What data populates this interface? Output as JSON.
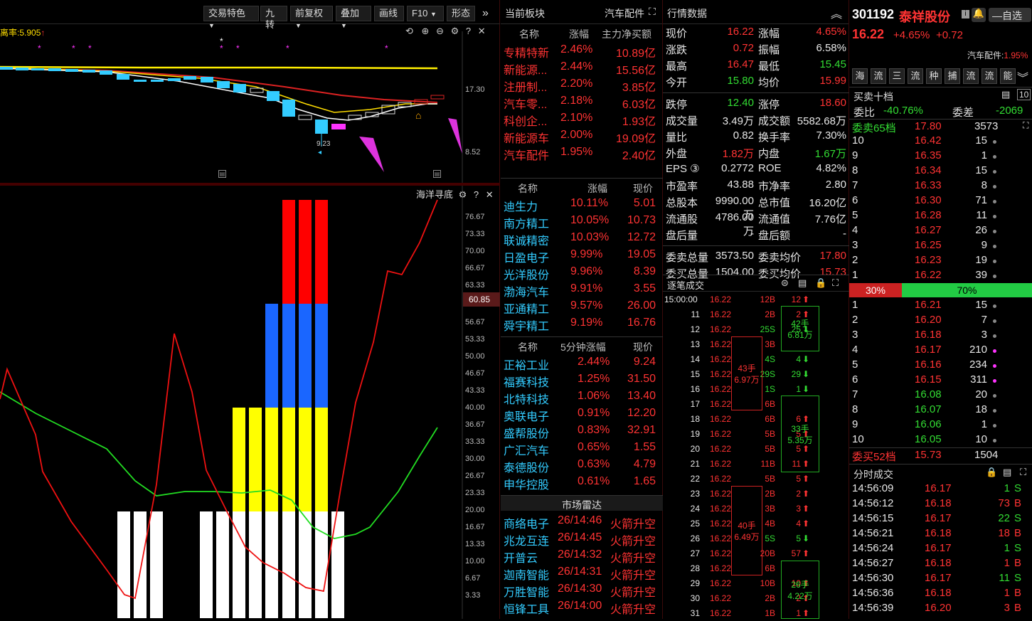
{
  "toolbar": {
    "items": [
      "交易特色",
      "九转",
      "前复权",
      "叠加",
      "画线",
      "F10",
      "形态"
    ],
    "ratio_label": "离率:5.905"
  },
  "kchart": {
    "axis": [
      "17.30",
      "8.52"
    ],
    "low_label": "9.23"
  },
  "indicator": {
    "name": "海洋寻底",
    "axis": [
      "76.67",
      "73.33",
      "70.00",
      "66.67",
      "63.33",
      "60.85",
      "56.67",
      "53.33",
      "50.00",
      "46.67",
      "43.33",
      "40.00",
      "36.67",
      "33.33",
      "30.00",
      "26.67",
      "23.33",
      "20.00",
      "16.67",
      "13.33",
      "10.00",
      "6.67",
      "3.33"
    ],
    "current_value": "60.85"
  },
  "sector": {
    "header": "当前板块",
    "current": "汽车配件",
    "cols": [
      "名称",
      "涨幅",
      "主力净买额"
    ],
    "rows": [
      {
        "name": "专精特新",
        "chg": "2.46%",
        "amt": "10.89亿"
      },
      {
        "name": "新能源...",
        "chg": "2.44%",
        "amt": "15.56亿"
      },
      {
        "name": "注册制...",
        "chg": "2.20%",
        "amt": "3.85亿"
      },
      {
        "name": "汽车零...",
        "chg": "2.18%",
        "amt": "6.03亿"
      },
      {
        "name": "科创企...",
        "chg": "2.10%",
        "amt": "1.93亿"
      },
      {
        "name": "新能源车",
        "chg": "2.00%",
        "amt": "19.09亿"
      },
      {
        "name": "汽车配件",
        "chg": "1.95%",
        "amt": "2.40亿"
      }
    ]
  },
  "leaders": {
    "cols": [
      "名称",
      "涨幅",
      "现价"
    ],
    "rows": [
      {
        "name": "迪生力",
        "chg": "10.11%",
        "price": "5.01"
      },
      {
        "name": "南方精工",
        "chg": "10.05%",
        "price": "10.73"
      },
      {
        "name": "联诚精密",
        "chg": "10.03%",
        "price": "12.72"
      },
      {
        "name": "日盈电子",
        "chg": "9.99%",
        "price": "19.05"
      },
      {
        "name": "光洋股份",
        "chg": "9.96%",
        "price": "8.39"
      },
      {
        "name": "渤海汽车",
        "chg": "9.91%",
        "price": "3.55"
      },
      {
        "name": "亚通精工",
        "chg": "9.57%",
        "price": "26.00"
      },
      {
        "name": "舜宇精工",
        "chg": "9.19%",
        "price": "16.76"
      }
    ]
  },
  "five_min": {
    "cols": [
      "名称",
      "5分钟涨幅",
      "现价"
    ],
    "rows": [
      {
        "name": "正裕工业",
        "chg": "2.44%",
        "price": "9.24"
      },
      {
        "name": "福赛科技",
        "chg": "1.25%",
        "price": "31.50"
      },
      {
        "name": "北特科技",
        "chg": "1.06%",
        "price": "13.40"
      },
      {
        "name": "奥联电子",
        "chg": "0.91%",
        "price": "12.20"
      },
      {
        "name": "盛帮股份",
        "chg": "0.83%",
        "price": "32.91"
      },
      {
        "name": "广汇汽车",
        "chg": "0.65%",
        "price": "1.55"
      },
      {
        "name": "泰德股份",
        "chg": "0.63%",
        "price": "4.79"
      },
      {
        "name": "申华控股",
        "chg": "0.61%",
        "price": "1.65"
      }
    ]
  },
  "radar": {
    "title": "市场雷达",
    "rows": [
      {
        "name": "商络电子",
        "time": "26/14:46",
        "event": "火箭升空"
      },
      {
        "name": "兆龙互连",
        "time": "26/14:45",
        "event": "火箭升空"
      },
      {
        "name": "开普云",
        "time": "26/14:32",
        "event": "火箭升空"
      },
      {
        "name": "迦南智能",
        "time": "26/14:31",
        "event": "火箭升空"
      },
      {
        "name": "万胜智能",
        "time": "26/14:30",
        "event": "火箭升空"
      },
      {
        "name": "恒锋工具",
        "time": "26/14:00",
        "event": "火箭升空"
      }
    ]
  },
  "quote": {
    "title": "行情数据",
    "rows": [
      [
        "现价",
        "16.22",
        "涨幅",
        "4.65%"
      ],
      [
        "涨跌",
        "0.72",
        "振幅",
        "6.58%"
      ],
      [
        "最高",
        "16.47",
        "最低",
        "15.45"
      ],
      [
        "今开",
        "15.80",
        "均价",
        "15.99"
      ],
      [
        "跌停",
        "12.40",
        "涨停",
        "18.60"
      ],
      [
        "成交量",
        "3.49万",
        "成交额",
        "5582.68万"
      ],
      [
        "量比",
        "0.82",
        "换手率",
        "7.30%"
      ],
      [
        "外盘",
        "1.82万",
        "内盘",
        "1.67万"
      ],
      [
        "EPS ③",
        "0.2772",
        "ROE",
        "4.82%"
      ],
      [
        "市盈率",
        "43.88",
        "市净率",
        "2.80"
      ],
      [
        "总股本",
        "9990.00万",
        "总市值",
        "16.20亿"
      ],
      [
        "流通股",
        "4786.00万",
        "流通值",
        "7.76亿"
      ],
      [
        "盘后量",
        "-",
        "盘后额",
        "-"
      ],
      [
        "委卖总量",
        "3573.50",
        "委卖均价",
        "17.80"
      ],
      [
        "委买总量",
        "1504.00",
        "委买均价",
        "15.73"
      ]
    ]
  },
  "ticks": {
    "title": "逐笔成交",
    "rows": [
      [
        "15:00:00",
        "16.22",
        "12B",
        "12"
      ],
      [
        "11",
        "16.22",
        "2B",
        "2"
      ],
      [
        "12",
        "16.22",
        "25S",
        "25"
      ],
      [
        "13",
        "16.22",
        "3B",
        ""
      ],
      [
        "14",
        "16.22",
        "4S",
        "4"
      ],
      [
        "15",
        "16.22",
        "29S",
        "29"
      ],
      [
        "16",
        "16.22",
        "1S",
        "1"
      ],
      [
        "17",
        "16.22",
        "6B",
        ""
      ],
      [
        "18",
        "16.22",
        "6B",
        "6"
      ],
      [
        "19",
        "16.22",
        "5B",
        "5"
      ],
      [
        "20",
        "16.22",
        "5B",
        "5"
      ],
      [
        "21",
        "16.22",
        "11B",
        "11"
      ],
      [
        "22",
        "16.22",
        "5B",
        "5"
      ],
      [
        "23",
        "16.22",
        "2B",
        "2"
      ],
      [
        "24",
        "16.22",
        "3B",
        "3"
      ],
      [
        "25",
        "16.22",
        "4B",
        "4"
      ],
      [
        "26",
        "16.22",
        "5S",
        "5"
      ],
      [
        "27",
        "16.22",
        "20B",
        "57"
      ],
      [
        "28",
        "16.22",
        "6B",
        ""
      ],
      [
        "29",
        "16.22",
        "10B",
        "10"
      ],
      [
        "30",
        "16.22",
        "2B",
        "2"
      ],
      [
        "31",
        "16.22",
        "1B",
        "1"
      ]
    ],
    "groups": [
      {
        "label": "42手",
        "amt": "6.81万"
      },
      {
        "label": "43手",
        "amt": "6.97万"
      },
      {
        "label": "33手",
        "amt": "5.35万"
      },
      {
        "label": "40手",
        "amt": "6.49万"
      },
      {
        "label": "26手",
        "amt": "4.22万"
      }
    ]
  },
  "stock": {
    "code": "301192",
    "name": "泰祥股份",
    "price": "16.22",
    "chg_pct": "+4.65%",
    "chg": "+0.72",
    "watch_label": "自选",
    "sector_label": "汽车配件:",
    "sector_chg": "1.95%"
  },
  "tabs": [
    "海",
    "流",
    "三",
    "流",
    "种",
    "捕",
    "流",
    "流",
    "能"
  ],
  "book": {
    "title": "买卖十档",
    "webi_label": "委比",
    "webi": "-40.76%",
    "weicha_label": "委差",
    "weicha": "-2069",
    "sell_label": "委卖65档",
    "sell_avg": "17.80",
    "sell_total": "3573",
    "asks": [
      [
        "10",
        "16.42",
        "15"
      ],
      [
        "9",
        "16.35",
        "1"
      ],
      [
        "8",
        "16.34",
        "15"
      ],
      [
        "7",
        "16.33",
        "8"
      ],
      [
        "6",
        "16.30",
        "71"
      ],
      [
        "5",
        "16.28",
        "11"
      ],
      [
        "4",
        "16.27",
        "26"
      ],
      [
        "3",
        "16.25",
        "9"
      ],
      [
        "2",
        "16.23",
        "19"
      ],
      [
        "1",
        "16.22",
        "39"
      ]
    ],
    "bar_sell": "30%",
    "bar_buy": "70%",
    "bids": [
      [
        "1",
        "16.21",
        "15"
      ],
      [
        "2",
        "16.20",
        "7"
      ],
      [
        "3",
        "16.18",
        "3"
      ],
      [
        "4",
        "16.17",
        "210"
      ],
      [
        "5",
        "16.16",
        "234"
      ],
      [
        "6",
        "16.15",
        "311"
      ],
      [
        "7",
        "16.08",
        "20"
      ],
      [
        "8",
        "16.07",
        "18"
      ],
      [
        "9",
        "16.06",
        "1"
      ],
      [
        "10",
        "16.05",
        "10"
      ]
    ],
    "buy_label": "委买52档",
    "buy_avg": "15.73",
    "buy_total": "1504"
  },
  "fenshi": {
    "title": "分时成交",
    "rows": [
      [
        "14:56:09",
        "16.17",
        "1",
        "S"
      ],
      [
        "14:56:12",
        "16.18",
        "73",
        "B"
      ],
      [
        "14:56:15",
        "16.17",
        "22",
        "S"
      ],
      [
        "14:56:21",
        "16.18",
        "18",
        "B"
      ],
      [
        "14:56:24",
        "16.17",
        "1",
        "S"
      ],
      [
        "14:56:27",
        "16.18",
        "1",
        "B"
      ],
      [
        "14:56:30",
        "16.17",
        "11",
        "S"
      ],
      [
        "14:56:36",
        "16.18",
        "1",
        "B"
      ],
      [
        "14:56:39",
        "16.20",
        "3",
        "B"
      ]
    ]
  }
}
